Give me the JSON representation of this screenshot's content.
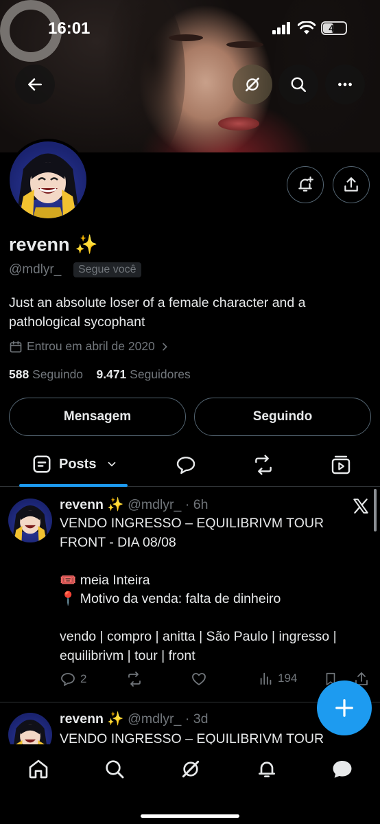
{
  "status_bar": {
    "time": "16:01",
    "battery": "47"
  },
  "profile": {
    "name": "revenn",
    "name_emoji": "✨",
    "handle": "@mdlyr_",
    "follows_you": "Segue você",
    "bio": "Just an absolute loser of a female character and a pathological sycophant",
    "joined": "Entrou em abril de 2020",
    "following_count": "588",
    "following_label": "Seguindo",
    "followers_count": "9.471",
    "followers_label": "Seguidores"
  },
  "buttons": {
    "message": "Mensagem",
    "following": "Seguindo"
  },
  "tabs": {
    "posts_label": "Posts"
  },
  "posts": [
    {
      "author": "revenn",
      "emoji": "✨",
      "handle": "@mdlyr_",
      "time": "· 6h",
      "lines": [
        "VENDO INGRESSO – EQUILIBRIVM TOUR",
        "FRONT - DIA 08/08",
        "",
        "🎟️ meia Inteira",
        "📍 Motivo da venda: falta de dinheiro",
        "",
        "vendo | compro | anitta | São Paulo | ingresso |",
        "equilibrivm | tour | front"
      ],
      "replies": "2",
      "views": "194"
    },
    {
      "author": "revenn",
      "emoji": "✨",
      "handle": "@mdlyr_",
      "time": "· 3d",
      "lines": [
        "VENDO INGRESSO – EQUILIBRIVM TOUR"
      ]
    }
  ],
  "colors": {
    "accent": "#1d9bf0",
    "muted": "#71767b",
    "border": "#2f3336"
  },
  "icons": [
    "back-arrow-icon",
    "grok-icon",
    "search-icon",
    "more-icon",
    "notification-add-icon",
    "share-icon",
    "calendar-icon",
    "chevron-right-icon",
    "post-tab-icon",
    "chevron-down-icon",
    "reply-tab-icon",
    "repost-tab-icon",
    "media-tab-icon",
    "x-logo-icon",
    "reply-icon",
    "repost-icon",
    "like-icon",
    "views-icon",
    "bookmark-icon",
    "share-post-icon",
    "compose-icon",
    "home-icon",
    "explore-icon",
    "grok-nav-icon",
    "notifications-icon",
    "messages-icon"
  ]
}
